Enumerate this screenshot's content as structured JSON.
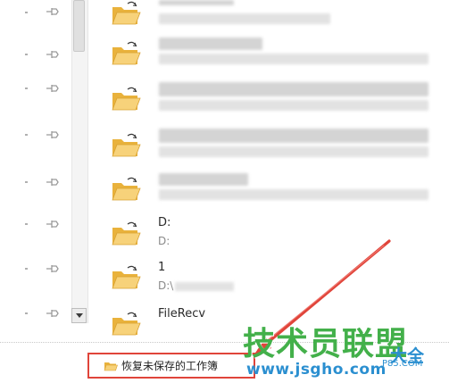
{
  "files": [
    {
      "name": "",
      "path": ""
    },
    {
      "name": "",
      "path": ""
    },
    {
      "name": "",
      "path": ""
    },
    {
      "name": "",
      "path": ""
    },
    {
      "name": "",
      "path": ""
    },
    {
      "name": "D:",
      "path": "D:"
    },
    {
      "name": "1",
      "path": "D:\\"
    },
    {
      "name": "FileRecv",
      "path": ""
    }
  ],
  "recover_button": {
    "label": "恢复未保存的工作簿"
  },
  "watermark": {
    "brand": "技术员联盟",
    "url": "www.jsgho.com",
    "side": "大全",
    "small": "P85.COM"
  },
  "colors": {
    "highlight_red": "#e0443a",
    "folder_yellow": "#f2c14e",
    "watermark_green": "#43b04a",
    "watermark_blue": "#2b8fd0"
  },
  "icons": [
    "pin-icon",
    "folder-open-icon",
    "scroll-down-arrow-icon",
    "folder-small-icon"
  ]
}
